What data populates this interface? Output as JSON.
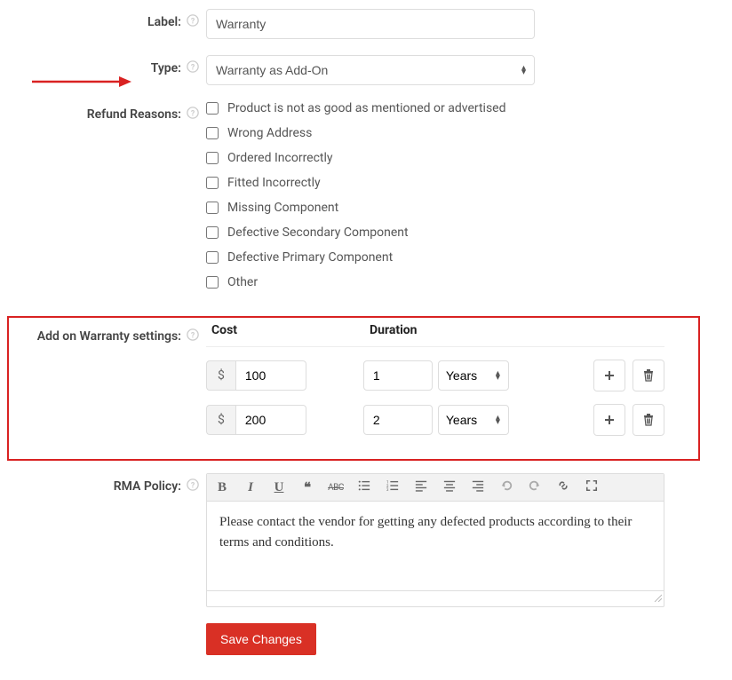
{
  "labels": {
    "label": "Label:",
    "type": "Type:",
    "refund_reasons": "Refund Reasons:",
    "addon_warranty": "Add on Warranty settings:",
    "rma_policy": "RMA Policy:"
  },
  "fields": {
    "label_value": "Warranty",
    "type_value": "Warranty as Add-On"
  },
  "refund_reasons": [
    "Product is not as good as mentioned or advertised",
    "Wrong Address",
    "Ordered Incorrectly",
    "Fitted Incorrectly",
    "Missing Component",
    "Defective Secondary Component",
    "Defective Primary Component",
    "Other"
  ],
  "warranty_table": {
    "headers": {
      "cost": "Cost",
      "duration": "Duration"
    },
    "currency": "$",
    "rows": [
      {
        "cost": "100",
        "duration_value": "1",
        "duration_unit": "Years"
      },
      {
        "cost": "200",
        "duration_value": "2",
        "duration_unit": "Years"
      }
    ]
  },
  "rma_policy_text": "Please contact the vendor for getting any defected products according to their terms and conditions.",
  "buttons": {
    "save": "Save Changes"
  },
  "toolbar": {
    "bold": "B",
    "italic": "I",
    "underline": "U",
    "quote": "❝",
    "strike": "ABC"
  }
}
